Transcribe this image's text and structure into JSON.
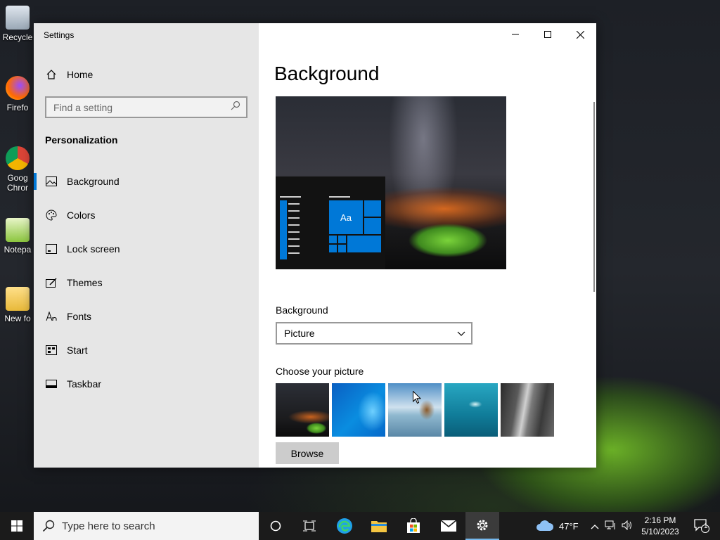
{
  "desktop": {
    "icons": [
      {
        "label": "Recycle"
      },
      {
        "label": "Firefo"
      },
      {
        "label": "Goog Chror"
      },
      {
        "label": "Notepa"
      },
      {
        "label": "New fo"
      }
    ]
  },
  "window": {
    "title": "Settings",
    "controls": {
      "minimize": "minimize-icon",
      "maximize": "maximize-icon",
      "close": "close-icon"
    }
  },
  "sidebar": {
    "home_label": "Home",
    "search_placeholder": "Find a setting",
    "section_title": "Personalization",
    "items": [
      {
        "label": "Background",
        "icon": "picture-icon",
        "active": true
      },
      {
        "label": "Colors",
        "icon": "palette-icon"
      },
      {
        "label": "Lock screen",
        "icon": "lock-screen-icon"
      },
      {
        "label": "Themes",
        "icon": "themes-icon"
      },
      {
        "label": "Fonts",
        "icon": "fonts-icon"
      },
      {
        "label": "Start",
        "icon": "start-icon"
      },
      {
        "label": "Taskbar",
        "icon": "taskbar-icon"
      }
    ]
  },
  "main": {
    "title": "Background",
    "preview_tile_text": "Aa",
    "background_label": "Background",
    "background_value": "Picture",
    "choose_label": "Choose your picture",
    "browse_label": "Browse"
  },
  "taskbar": {
    "search_placeholder": "Type here to search",
    "weather": "47°F",
    "time": "2:16 PM",
    "date": "5/10/2023",
    "notification_count": "1"
  },
  "colors": {
    "accent": "#0078d7",
    "sidebar_bg": "#e6e6e6",
    "taskbar_bg": "#1b1b1b"
  }
}
